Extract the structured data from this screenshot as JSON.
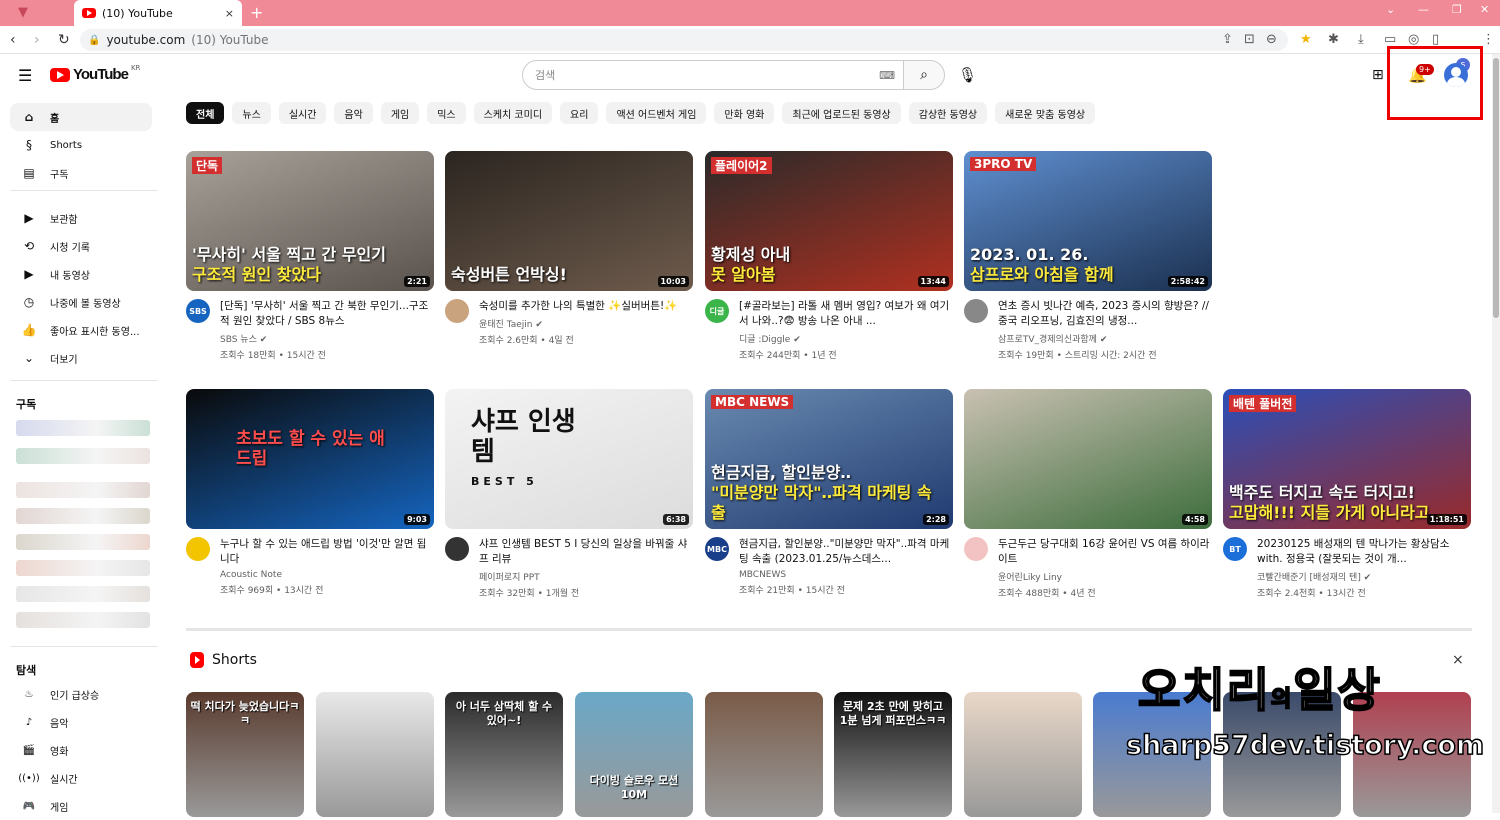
{
  "browser": {
    "tab_title": "(10) YouTube",
    "tab_close": "×",
    "new_tab": "+",
    "url": "youtube.com",
    "url_title": "(10) YouTube",
    "profile_initial": "s"
  },
  "header": {
    "logo_text": "YouTube",
    "logo_region": "KR",
    "search_placeholder": "검색",
    "notification_badge": "9+"
  },
  "sidebar": {
    "main": [
      {
        "label": "홈",
        "icon": "home-icon",
        "glyph": "⌂"
      },
      {
        "label": "Shorts",
        "icon": "shorts-icon",
        "glyph": "§"
      },
      {
        "label": "구독",
        "icon": "subscriptions-icon",
        "glyph": "▤"
      }
    ],
    "library": [
      {
        "label": "보관함",
        "icon": "library-icon",
        "glyph": "▶"
      },
      {
        "label": "시청 기록",
        "icon": "history-icon",
        "glyph": "⟲"
      },
      {
        "label": "내 동영상",
        "icon": "my-videos-icon",
        "glyph": "▶"
      },
      {
        "label": "나중에 볼 동영상",
        "icon": "watch-later-icon",
        "glyph": "◷"
      },
      {
        "label": "좋아요 표시한 동영...",
        "icon": "liked-icon",
        "glyph": "👍"
      },
      {
        "label": "더보기",
        "icon": "chevron-down-icon",
        "glyph": "⌄"
      }
    ],
    "subscriptions_heading": "구독",
    "explore_heading": "탐색",
    "explore": [
      {
        "label": "인기 급상승",
        "icon": "trending-icon",
        "glyph": "♨"
      },
      {
        "label": "음악",
        "icon": "music-icon",
        "glyph": "♪"
      },
      {
        "label": "영화",
        "icon": "movies-icon",
        "glyph": "🎬"
      },
      {
        "label": "실시간",
        "icon": "live-icon",
        "glyph": "((•))"
      },
      {
        "label": "게임",
        "icon": "gaming-icon",
        "glyph": "🎮"
      }
    ]
  },
  "chips": [
    "전체",
    "뉴스",
    "실시간",
    "음악",
    "게임",
    "믹스",
    "스케치 코미디",
    "요리",
    "액션 어드벤처 게임",
    "만화 영화",
    "최근에 업로드된 동영상",
    "감상한 동영상",
    "새로운 맞춤 동영상"
  ],
  "videos": [
    {
      "title": "[단독] '무사히' 서울 찍고 간 북한 무인기...구조적 원인 찾았다 / SBS 8뉴스",
      "channel": "SBS 뉴스 ✔",
      "stats": "조회수 18만회 • 15시간 전",
      "duration": "2:21",
      "thumb_text": "'무사히' 서울 찍고 간 무인기",
      "thumb_sub": "구조적 원인 찾았다",
      "thumb_tag": "단독",
      "avatar": "SBS"
    },
    {
      "title": "숙성미를 추가한 나의 특별한 ✨실버버튼!✨",
      "channel": "윤태진 Taejin ✔",
      "stats": "조회수 2.6만회 • 4일 전",
      "duration": "10:03",
      "thumb_text": "숙성버튼 언박싱!",
      "thumb_sub": "",
      "thumb_tag": "",
      "avatar": ""
    },
    {
      "title": "[#골라보는] 라톨 새 멤버 영입? 여보가 왜 여기서 나와..?😨 방송 나온 아내 ...",
      "channel": "디글 :Diggle ✔",
      "stats": "조회수 244만회 • 1년 전",
      "duration": "13:44",
      "thumb_text": "황제성 아내",
      "thumb_sub": "못 알아봄",
      "thumb_tag": "플레이어2",
      "avatar": "디글"
    },
    {
      "title": "연초 증시 빗나간 예측, 2023 증시의 향방은? // 중국 리오프닝, 김효진의 냉정...",
      "channel": "삼프로TV_경제의신과함께 ✔",
      "stats": "조회수 19만회 • 스트리밍 시간: 2시간 전",
      "duration": "2:58:42",
      "thumb_text": "2023. 01. 26.",
      "thumb_sub": "삼프로와 아침을 함께",
      "thumb_tag": "3PRO TV",
      "avatar": ""
    },
    {
      "title": "누구나 할 수 있는 애드립 방법 '이것'만 알면 됩니다",
      "channel": "Acoustic Note",
      "stats": "조회수 969회 • 13시간 전",
      "duration": "9:03",
      "thumb_text": "초보도 할 수 있는 애드립",
      "thumb_sub": "",
      "thumb_tag": "",
      "avatar": ""
    },
    {
      "title": "샤프 인생템 BEST 5 I 당신의 일상을 바꿔줄 샤프 리뷰",
      "channel": "페이퍼로지 PPT",
      "stats": "조회수 32만회 • 1개월 전",
      "duration": "6:38",
      "thumb_text": "샤프 인생템",
      "thumb_sub": "BEST 5",
      "thumb_tag": "",
      "avatar": ""
    },
    {
      "title": "현금지급, 할인분양..\"미분양만 막자\"..파격 마케팅 속출 (2023.01.25/뉴스데스...",
      "channel": "MBCNEWS",
      "stats": "조회수 21만회 • 15시간 전",
      "duration": "2:28",
      "thumb_text": "현금지급, 할인분양‥",
      "thumb_sub": "\"미분양만 막자\"‥파격 마케팅 속출",
      "thumb_tag": "MBC NEWS",
      "avatar": "MBC"
    },
    {
      "title": "두근두근 당구대회 16강 윤어린 VS 여름 하이라이트",
      "channel": "윤어린Liky Liny",
      "stats": "조회수 488만회 • 4년 전",
      "duration": "4:58",
      "thumb_text": "",
      "thumb_sub": "",
      "thumb_tag": "",
      "avatar": ""
    },
    {
      "title": "20230125 배성재의 텐 막나가는 황상담소 with. 정용국 (잘못되는 것이 개...",
      "channel": "코빨간배준기 [배성재의 텐] ✔",
      "stats": "조회수 2.4천회 • 13시간 전",
      "duration": "1:18:51",
      "thumb_text": "백주도 터지고 속도 터지고!",
      "thumb_sub": "고맙해!!! 지들 가게 아니라고...",
      "thumb_tag": "배텐 풀버전",
      "avatar": "BT"
    }
  ],
  "shorts": {
    "heading": "Shorts",
    "close": "×",
    "items": [
      {
        "text": "떡 치다가 늦었습니다ㅋㅋ",
        "color": "#5a3b2e"
      },
      {
        "text": "",
        "color": "#e8e8e8"
      },
      {
        "text": "아 너두 삼딱체 할 수 있어~!",
        "color": "#2b2b2b"
      },
      {
        "text": "다이빙 슬로우 모션 10M",
        "color": "#6aa8c8"
      },
      {
        "text": "",
        "color": "#7a5b48"
      },
      {
        "text": "문제 2초 만에 맞히고 1분 넘게 퍼포먼스ㅋㅋ",
        "color": "#111111"
      },
      {
        "text": "",
        "color": "#e9d8c8"
      },
      {
        "text": "",
        "color": "#4a7bd0"
      },
      {
        "text": "",
        "color": "#3a4a6a"
      },
      {
        "text": "",
        "color": "#b04050"
      }
    ]
  },
  "watermark": {
    "title_a": "오치리",
    "title_b": "의",
    "title_c": "일상",
    "url": "sharp57dev.tistory.com"
  },
  "colors": {
    "accent": "#ff0000",
    "highlight_box": "#ee0000",
    "tabbar": "#f08a96"
  }
}
